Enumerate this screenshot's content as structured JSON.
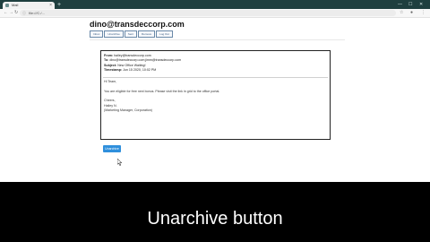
{
  "browser": {
    "tab_title": "Mail",
    "url": "file:///C:/...",
    "new_tab_symbol": "+"
  },
  "page": {
    "title": "dino@transdeccorp.com",
    "toolbar_buttons": [
      "Inbox",
      "Unarchive",
      "Sent",
      "Remove",
      "Log Out"
    ],
    "email": {
      "from_label": "From:",
      "from_value": "hailey@transdeccorp.com",
      "to_label": "To:",
      "to_value": "dino@transdeccorp.com;jimm@transdeccorp.com",
      "subject_label": "Subject:",
      "subject_value": "New Office Waiting!",
      "timestamp_label": "Timestamp:",
      "timestamp_value": "Jun 15 2020, 10:02 PM",
      "body_lines": [
        "Hi Team,",
        "You are eligible for free next bonus. Please visit the link in grid to the office portal.",
        "Cheers,",
        "Hailey N.",
        "(Marketing Manager, Corporation)"
      ]
    },
    "action_button": "Unarchive"
  },
  "caption": "Unarchive button",
  "colors": {
    "accent": "#2f8fdc",
    "tab_strip": "#1f3f3f",
    "caption_bg": "#000000"
  }
}
